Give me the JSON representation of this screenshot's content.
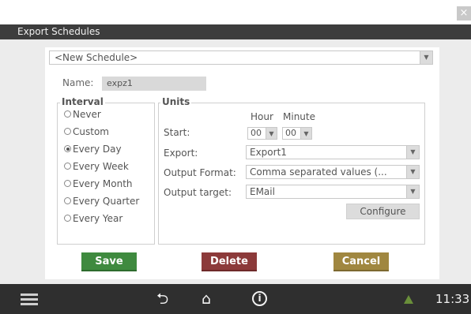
{
  "window": {
    "title": "Export Schedules",
    "close_glyph": "×"
  },
  "schedule": {
    "selected": "<New Schedule>"
  },
  "name": {
    "label": "Name:",
    "value": "expz1"
  },
  "interval": {
    "legend": "Interval",
    "options": [
      "Never",
      "Custom",
      "Every Day",
      "Every Week",
      "Every Month",
      "Every Quarter",
      "Every Year"
    ],
    "selected": "Every Day"
  },
  "units": {
    "legend": "Units",
    "hour_header": "Hour",
    "minute_header": "Minute",
    "start_label": "Start:",
    "hour_value": "00",
    "minute_value": "00",
    "export_label": "Export:",
    "export_value": "Export1",
    "output_format_label": "Output Format:",
    "output_format_value": "Comma separated values (...",
    "output_target_label": "Output target:",
    "output_target_value": "EMail",
    "configure_label": "Configure"
  },
  "actions": {
    "save": "Save",
    "delete": "Delete",
    "cancel": "Cancel"
  },
  "taskbar": {
    "time": "11:33"
  },
  "icons": {
    "menu": "menu-icon",
    "back": "back-icon",
    "home": "home-icon",
    "info": "info-icon",
    "warning": "warning-icon",
    "dropdown": "chevron-down-icon"
  },
  "colors": {
    "save": "#3f8a3f",
    "delete": "#8c3a3a",
    "cancel": "#a08740",
    "titlebar": "#3d3d3d",
    "taskbar": "#2f2f2f"
  }
}
